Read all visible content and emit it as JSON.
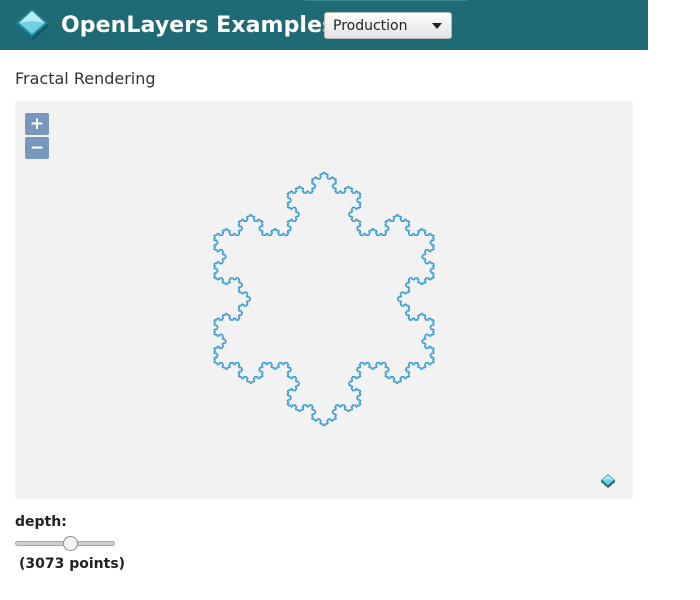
{
  "header": {
    "brand_title": "OpenLayers Examples",
    "brand_color": "#1f6b75",
    "logo_icon": "openlayers-logo-icon",
    "mode_select": {
      "selected": "Production"
    }
  },
  "page": {
    "title": "Fractal Rendering"
  },
  "map": {
    "background": "#f2f2f2",
    "stroke_color": "#3399cc",
    "zoom_in_label": "+",
    "zoom_out_label": "−",
    "attribution_icon": "openlayers-logo-icon"
  },
  "controls": {
    "depth_label": "depth:",
    "depth_level": 5,
    "depth_max": 9,
    "points_text": "(3073 points)"
  }
}
